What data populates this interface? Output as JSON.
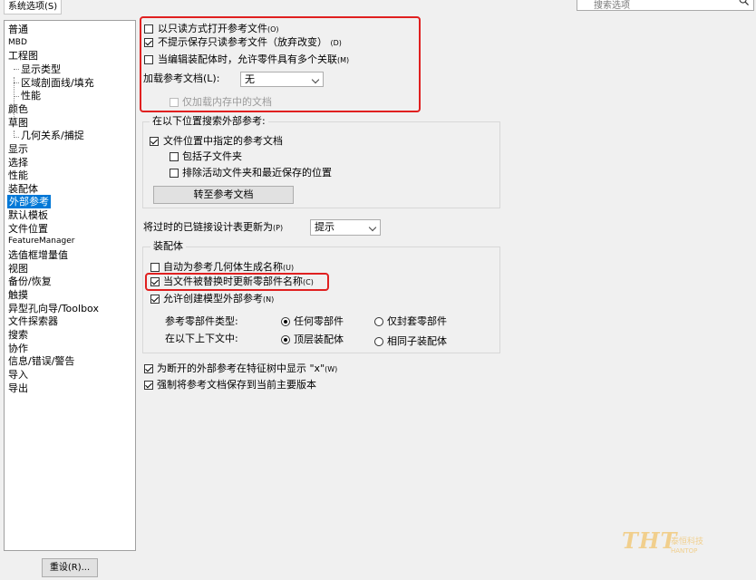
{
  "tab": {
    "title": "系统选项(S)"
  },
  "search": {
    "placeholder": "搜索选项"
  },
  "tree": [
    {
      "label": "普通",
      "level": 0
    },
    {
      "label": "MBD",
      "level": 0,
      "small": true
    },
    {
      "label": "工程图",
      "level": 0
    },
    {
      "label": "显示类型",
      "level": 1
    },
    {
      "label": "区域剖面线/填充",
      "level": 1
    },
    {
      "label": "性能",
      "level": 1
    },
    {
      "label": "颜色",
      "level": 0
    },
    {
      "label": "草图",
      "level": 0
    },
    {
      "label": "几何关系/捕捉",
      "level": 1
    },
    {
      "label": "显示",
      "level": 0
    },
    {
      "label": "选择",
      "level": 0
    },
    {
      "label": "性能",
      "level": 0
    },
    {
      "label": "装配体",
      "level": 0
    },
    {
      "label": "外部参考",
      "level": 0,
      "selected": true
    },
    {
      "label": "默认模板",
      "level": 0
    },
    {
      "label": "文件位置",
      "level": 0
    },
    {
      "label": "FeatureManager",
      "level": 0,
      "small": true
    },
    {
      "label": "选值框增量值",
      "level": 0
    },
    {
      "label": "视图",
      "level": 0
    },
    {
      "label": "备份/恢复",
      "level": 0
    },
    {
      "label": "触摸",
      "level": 0
    },
    {
      "label": "异型孔向导/Toolbox",
      "level": 0
    },
    {
      "label": "文件探索器",
      "level": 0
    },
    {
      "label": "搜索",
      "level": 0
    },
    {
      "label": "协作",
      "level": 0
    },
    {
      "label": "信息/错误/警告",
      "level": 0
    },
    {
      "label": "导入",
      "level": 0
    },
    {
      "label": "导出",
      "level": 0
    }
  ],
  "reset": {
    "label": "重设(R)..."
  },
  "top": {
    "open_readonly": {
      "label": "以只读方式打开参考文件",
      "key": "(O)",
      "checked": false
    },
    "no_prompt": {
      "label": "不提示保存只读参考文件（放弃改变）",
      "key": "(D)",
      "checked": true
    },
    "multi_context": {
      "label": "当编辑装配体时，允许零件具有多个关联",
      "key": "(M)",
      "checked": false
    },
    "load_label": "加载参考文档(L):",
    "load_value": "无",
    "mem_only": {
      "label": "仅加载内存中的文档",
      "checked": false,
      "disabled": true
    }
  },
  "search_group": {
    "title": "在以下位置搜索外部参考:",
    "file_loc": {
      "label": "文件位置中指定的参考文档",
      "checked": true
    },
    "subfolders": {
      "label": "包括子文件夹",
      "checked": false
    },
    "exclude": {
      "label": "排除活动文件夹和最近保存的位置",
      "checked": false
    },
    "goto_button": "转至参考文档"
  },
  "outdated": {
    "label": "将过时的已链接设计表更新为",
    "key": "(P)",
    "value": "提示"
  },
  "assembly_group": {
    "title": "装配体",
    "auto_name": {
      "label": "自动为参考几何体生成名称",
      "key": "(U)",
      "checked": false
    },
    "update_names": {
      "label": "当文件被替换时更新零部件名称",
      "key": "(C)",
      "checked": true
    },
    "allow_ext": {
      "label": "允许创建模型外部参考",
      "key": "(N)",
      "checked": true
    },
    "ref_type_label": "参考零部件类型:",
    "ref_type_any": {
      "label": "任何零部件",
      "selected": true
    },
    "ref_type_closed": {
      "label": "仅封套零部件",
      "selected": false
    },
    "context_label": "在以下上下文中:",
    "ctx_top": {
      "label": "顶层装配体",
      "selected": true
    },
    "ctx_same": {
      "label": "相同子装配体",
      "selected": false
    }
  },
  "broken": {
    "label": "为断开的外部参考在特征树中显示 \"x\"",
    "key": "(W)",
    "checked": true
  },
  "force_save": {
    "label": "强制将参考文档保存到当前主要版本",
    "checked": true
  },
  "watermark": {
    "logo": "THT",
    "name": "泰恒科技",
    "sub": "HANTOP"
  },
  "colors": {
    "highlight": "#e02020",
    "selection": "#0078d7",
    "watermark": "#f1cf8d"
  }
}
